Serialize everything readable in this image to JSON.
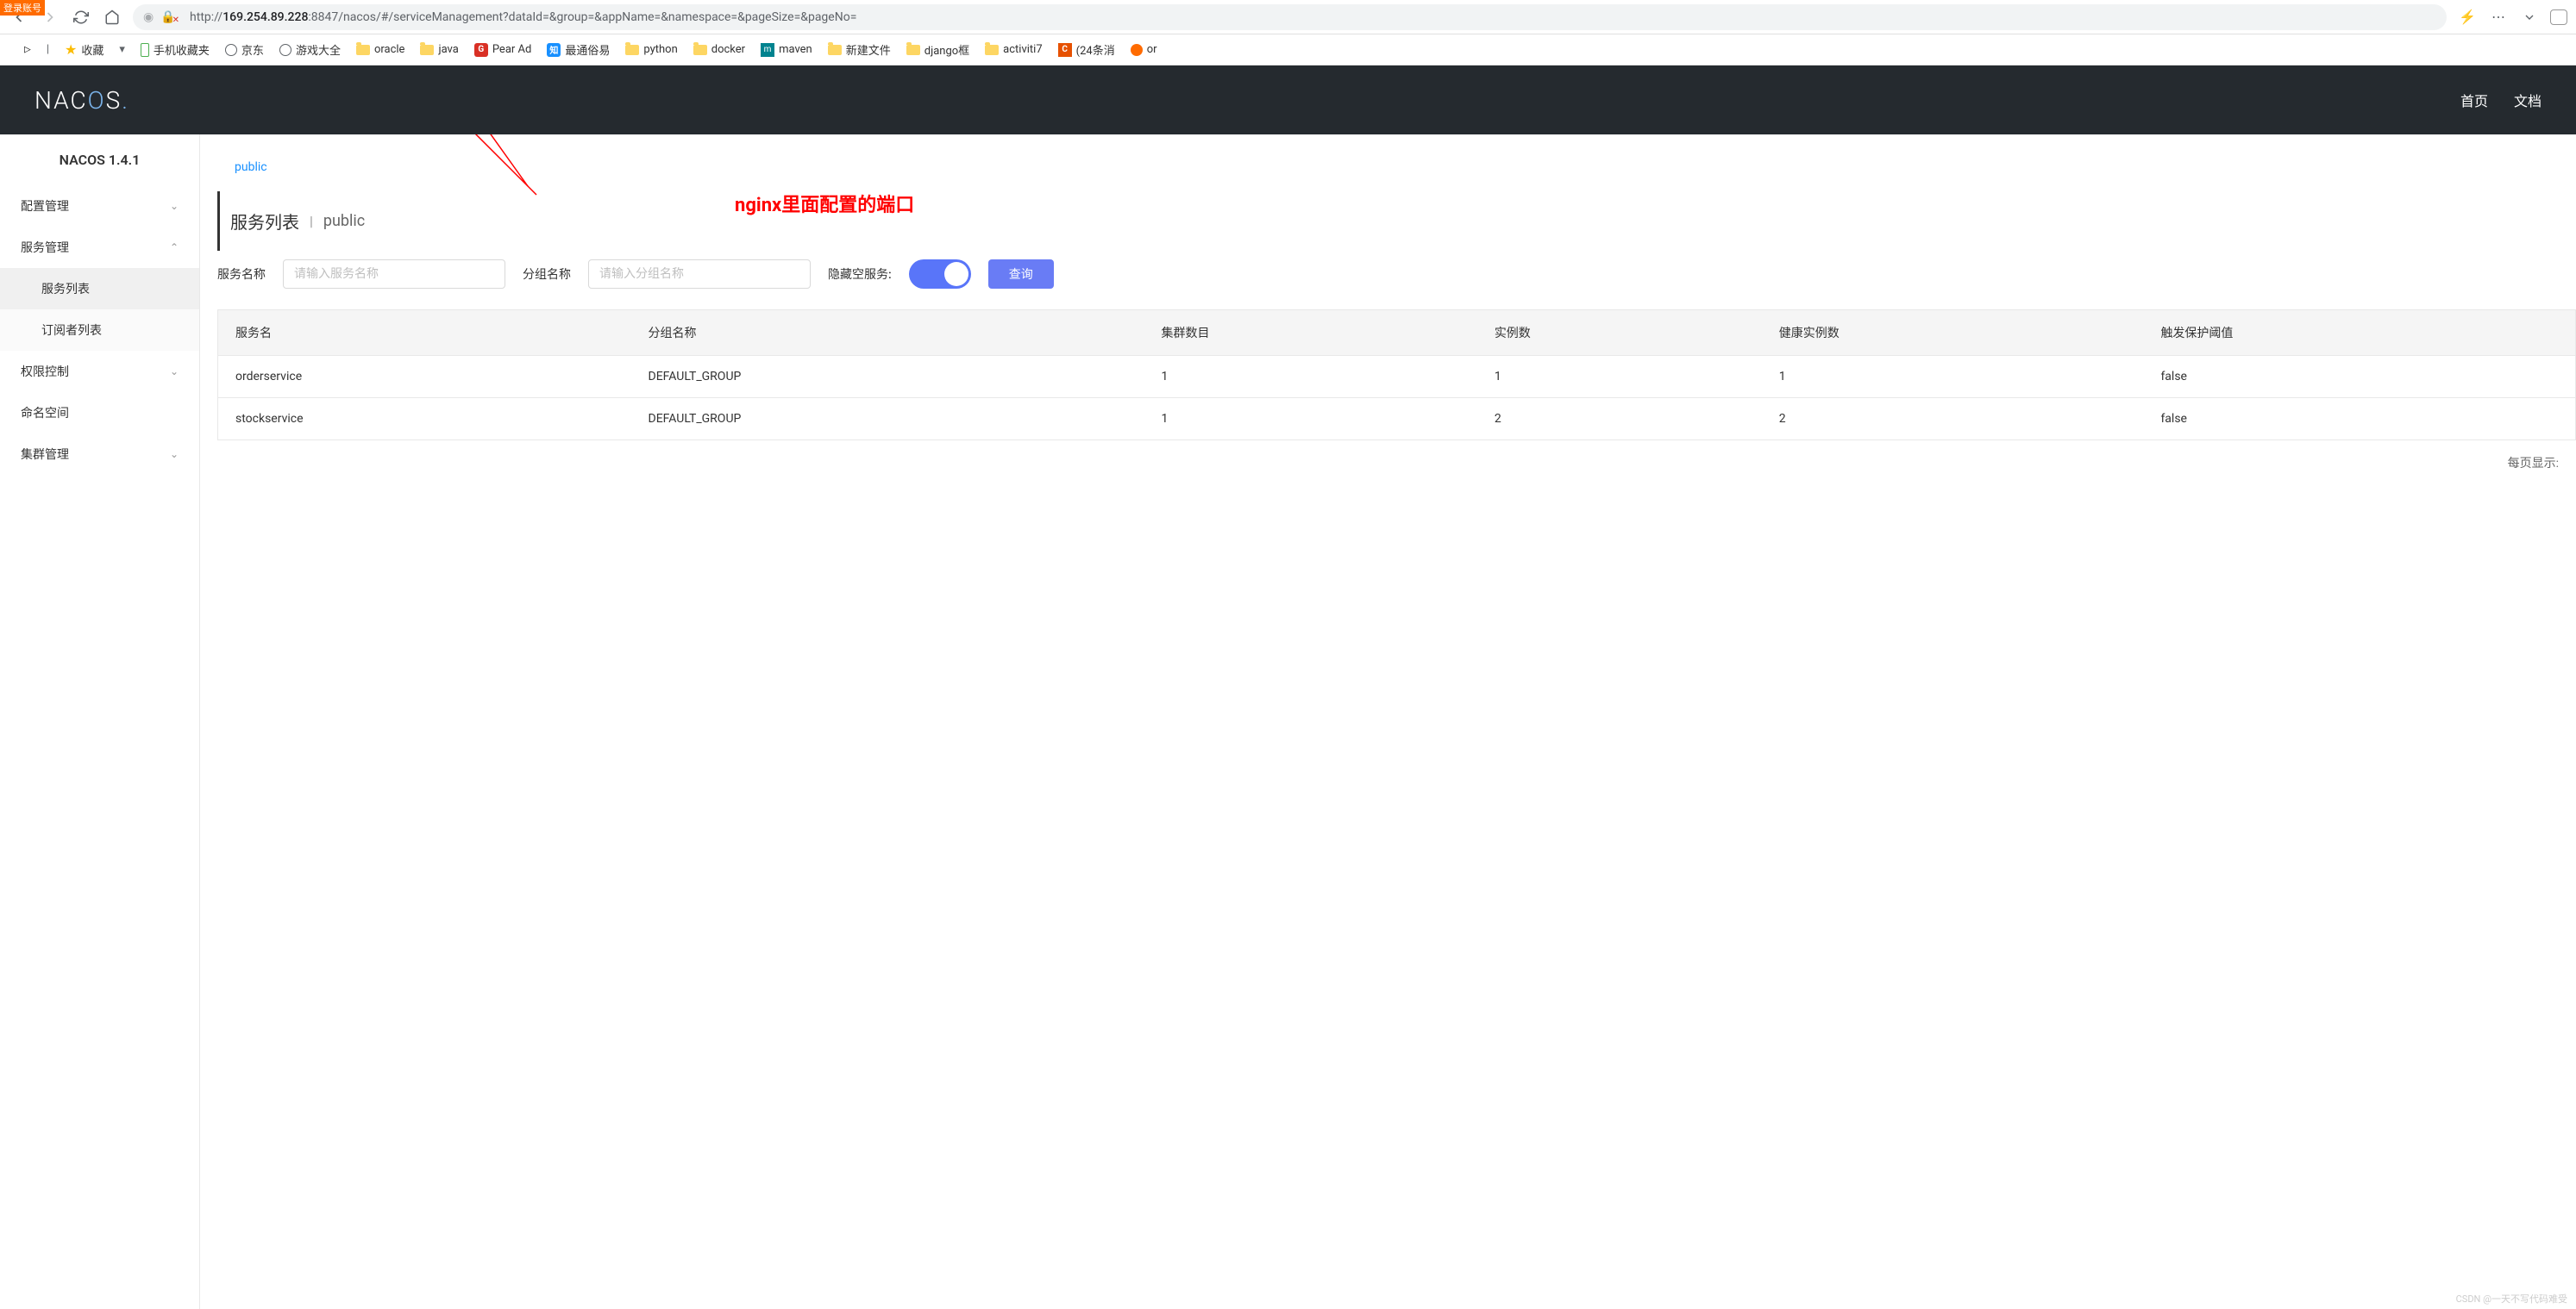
{
  "browser": {
    "login_badge": "登录账号",
    "url_protocol": "http://",
    "url_host": "169.254.89.228",
    "url_port": ":8847",
    "url_path": "/nacos/#/serviceManagement?dataId=&group=&appName=&namespace=&pageSize=&pageNo="
  },
  "bookmarks": {
    "favorites": "收藏",
    "mobile": "手机收藏夹",
    "jd": "京东",
    "games": "游戏大全",
    "oracle": "oracle",
    "java": "java",
    "pear": "Pear Ad",
    "zhihu": "最通俗易",
    "python": "python",
    "docker": "docker",
    "maven": "maven",
    "newfile": "新建文件",
    "django": "django框",
    "activiti": "activiti7",
    "csdn": "(24条消",
    "or": "or"
  },
  "header": {
    "logo": "NACOS.",
    "nav_home": "首页",
    "nav_docs": "文档"
  },
  "sidebar": {
    "version": "NACOS 1.4.1",
    "config_mgmt": "配置管理",
    "service_mgmt": "服务管理",
    "service_list": "服务列表",
    "subscriber_list": "订阅者列表",
    "permission": "权限控制",
    "namespace": "命名空间",
    "cluster": "集群管理"
  },
  "content": {
    "namespace_tab": "public",
    "title": "服务列表",
    "title_ns": "public",
    "label_service": "服务名称",
    "placeholder_service": "请输入服务名称",
    "label_group": "分组名称",
    "placeholder_group": "请输入分组名称",
    "label_hide": "隐藏空服务:",
    "btn_query": "查询",
    "table": {
      "headers": {
        "service_name": "服务名",
        "group_name": "分组名称",
        "cluster_count": "集群数目",
        "instance_count": "实例数",
        "healthy_count": "健康实例数",
        "threshold": "触发保护阈值"
      },
      "rows": [
        {
          "service_name": "orderservice",
          "group_name": "DEFAULT_GROUP",
          "cluster_count": "1",
          "instance_count": "1",
          "healthy_count": "1",
          "threshold": "false"
        },
        {
          "service_name": "stockservice",
          "group_name": "DEFAULT_GROUP",
          "cluster_count": "1",
          "instance_count": "2",
          "healthy_count": "2",
          "threshold": "false"
        }
      ]
    },
    "pagination": "每页显示:"
  },
  "annotation": {
    "text": "nginx里面配置的端口"
  },
  "watermark": "CSDN @一天不写代码难受"
}
